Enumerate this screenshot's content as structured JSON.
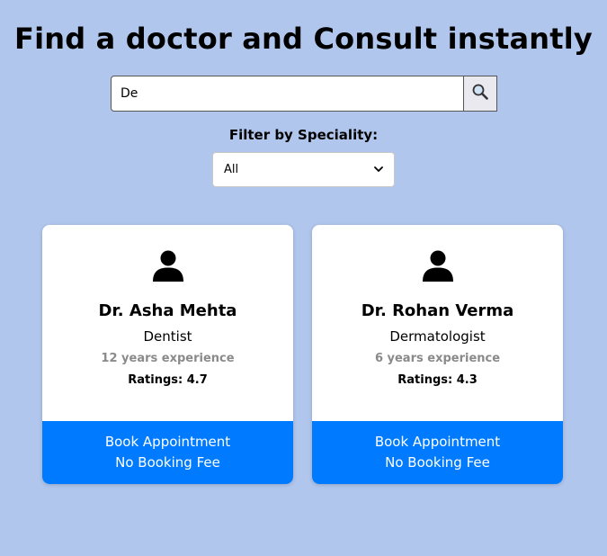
{
  "header": {
    "title": "Find a doctor and Consult instantly"
  },
  "search": {
    "value": "De",
    "button_icon": "magnifier-icon"
  },
  "filter": {
    "label": "Filter by Speciality:",
    "selected": "All"
  },
  "doctors": [
    {
      "name": "Dr. Asha Mehta",
      "speciality": "Dentist",
      "experience": "12 years experience",
      "rating": "Ratings: 4.7",
      "book_line1": "Book Appointment",
      "book_line2": "No Booking Fee",
      "icon": "user-icon"
    },
    {
      "name": "Dr. Rohan Verma",
      "speciality": "Dermatologist",
      "experience": "6 years experience",
      "rating": "Ratings: 4.3",
      "book_line1": "Book Appointment",
      "book_line2": "No Booking Fee",
      "icon": "user-icon"
    }
  ],
  "colors": {
    "background": "#b0c6ec",
    "accent": "#007bff",
    "muted_text": "#8a8a8a"
  }
}
